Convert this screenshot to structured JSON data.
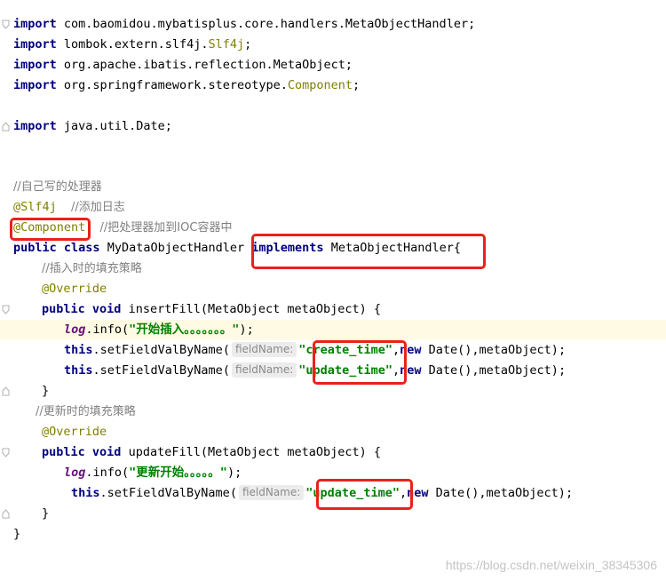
{
  "editor": {
    "imports": [
      {
        "keyword": "import",
        "path": "com.baomidou.mybatisplus.core.handlers.MetaObjectHandler",
        "path_colored": "",
        "end": ";"
      },
      {
        "keyword": "import",
        "path": "lombok.extern.slf4j.",
        "path_colored": "Slf4j",
        "end": ";"
      },
      {
        "keyword": "import",
        "path": "org.apache.ibatis.reflection.MetaObject",
        "path_colored": "",
        "end": ";"
      },
      {
        "keyword": "import",
        "path": "org.springframework.stereotype.",
        "path_colored": "Component",
        "end": ";"
      },
      {
        "keyword": "import",
        "path": "java.util.Date",
        "path_colored": "",
        "end": ";"
      }
    ],
    "comment_handler": "//自己写的处理器",
    "ann_slf4j": "@Slf4j",
    "comment_slf4j": "//添加日志",
    "ann_component": "@Component",
    "comment_component": "//把处理器加到IOC容器中",
    "class_decl": {
      "kw_public": "public",
      "kw_class": "class",
      "name": "MyDataObjectHandler",
      "kw_implements": "implements",
      "iface": "MetaObjectHandler{"
    },
    "insert_comment": "//插入时的填充策略",
    "override": "@Override",
    "insert_sig": {
      "kw_public": "public",
      "kw_void": "void",
      "rest": "insertFill(MetaObject metaObject) {"
    },
    "log_field": "log",
    "log_method": ".info(",
    "insert_log_msg": "\"开始插入。。。。。。。\"",
    "close_paren_semi": ");",
    "this_kw": "this",
    "set_call": ".setFieldValByName(",
    "hint_label": "fieldName:",
    "create_time": "\"create_time\"",
    "update_time": "\"update_time\"",
    "comma": ",",
    "new_kw": "new",
    "tail_args": "Date(),metaObject);",
    "close_brace": "}",
    "update_comment": "//更新时的填充策略",
    "update_sig": {
      "kw_public": "public",
      "kw_void": "void",
      "rest": "updateFill(MetaObject metaObject) {"
    },
    "update_log_msg": "\"更新开始。。。。。\"",
    "class_close": "}"
  },
  "watermark": "https://blog.csdn.net/weixin_38345306",
  "colors": {
    "keyword": "#000080",
    "string": "#008000",
    "comment": "#808080",
    "annotation": "#808000",
    "highlight_box": "#e8221a",
    "caret_line": "#fffae3"
  }
}
